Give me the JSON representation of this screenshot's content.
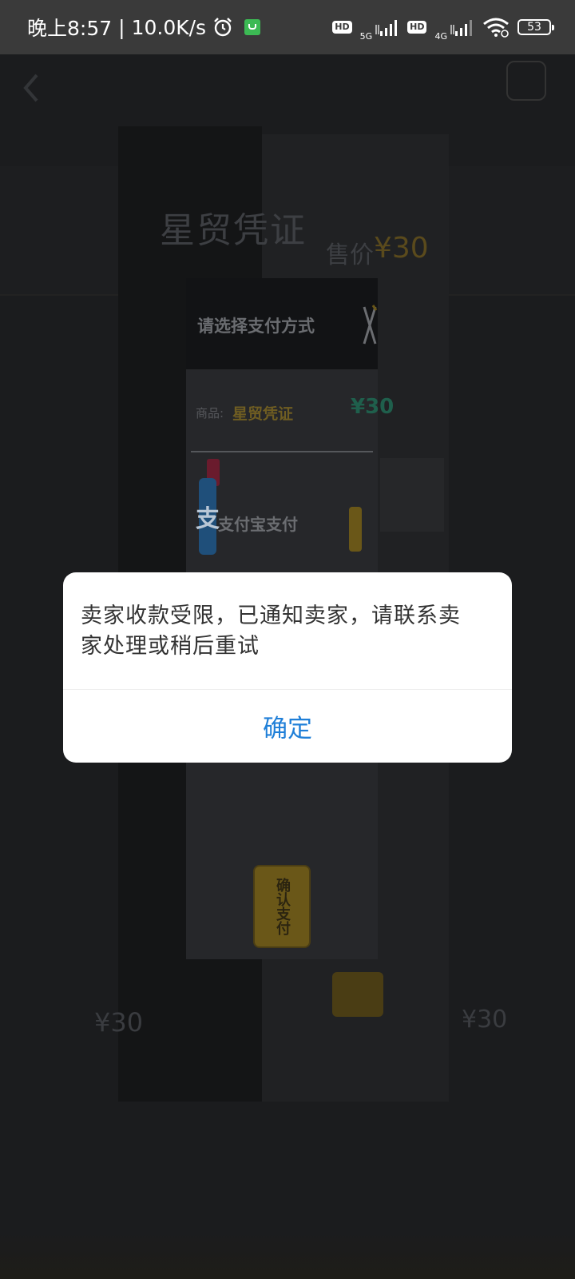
{
  "status_bar": {
    "time": "晚上8:57",
    "net_speed": "10.0K/s",
    "separator": "|",
    "sim1_type": "5G",
    "sim2_type": "4G",
    "hd_label": "HD",
    "battery": "53"
  },
  "background": {
    "product_title": "星贸凭证",
    "price_label": "售价",
    "price": "¥30",
    "left_price": "¥30",
    "right_price": "¥30"
  },
  "payment_sheet": {
    "title": "请选择支付方式",
    "item_label": "商品:",
    "item_name": "星贸凭证",
    "item_price": "¥30",
    "method_label": "支付宝支付",
    "alipay_glyph": "支",
    "confirm_label": "确认支付"
  },
  "dialog": {
    "message": "卖家收款受限，已通知卖家，请联系卖家处理或稍后重试",
    "ok_label": "确定",
    "ok_color": "#1f7fd8"
  }
}
